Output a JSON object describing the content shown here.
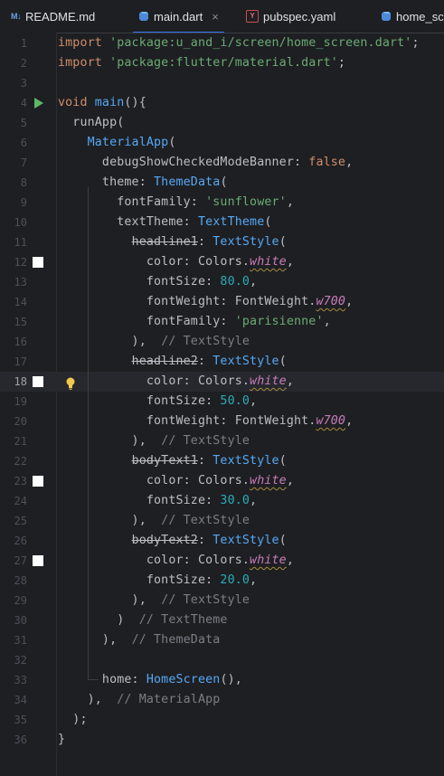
{
  "tabs": [
    {
      "label": "README.md",
      "icon": "markdown-icon",
      "active": false
    },
    {
      "label": "main.dart",
      "icon": "dart-icon",
      "active": true
    },
    {
      "label": "pubspec.yaml",
      "icon": "yaml-icon",
      "active": false
    },
    {
      "label": "home_sc",
      "icon": "dart-icon",
      "active": false
    }
  ],
  "tab_close_glyph": "×",
  "icon_texts": {
    "markdown": "M↓",
    "yaml": "Y"
  },
  "current_line": 18,
  "colors": {
    "keyword": "#cf8e6d",
    "string": "#6aab73",
    "function": "#56a8f5",
    "number": "#2aacb8",
    "comment": "#7a7e85",
    "field": "#c77dbb",
    "default": "#bcbec4",
    "accent": "#3574f0"
  },
  "gutter_markers": {
    "run_line": 4,
    "square_lines": [
      12,
      18,
      23,
      27
    ],
    "bulb_line": 18
  },
  "code_lines": [
    [
      [
        "kw",
        "import "
      ],
      [
        "str",
        "'package:u_and_i/screen/home_screen.dart'"
      ],
      [
        "",
        "; "
      ]
    ],
    [
      [
        "kw",
        "import "
      ],
      [
        "str",
        "'package:flutter/material.dart'"
      ],
      [
        "",
        ";"
      ]
    ],
    [],
    [
      [
        "kw",
        "void "
      ],
      [
        "fn",
        "main"
      ],
      [
        "",
        "(){"
      ]
    ],
    [
      [
        "",
        "  runApp("
      ]
    ],
    [
      [
        "",
        "    "
      ],
      [
        "cls",
        "MaterialApp"
      ],
      [
        "",
        "("
      ]
    ],
    [
      [
        "",
        "      debugShowCheckedModeBanner: "
      ],
      [
        "kw",
        "false"
      ],
      [
        "",
        ","
      ]
    ],
    [
      [
        "",
        "      theme: "
      ],
      [
        "cls",
        "ThemeData"
      ],
      [
        "",
        "("
      ]
    ],
    [
      [
        "",
        "        fontFamily: "
      ],
      [
        "str",
        "'sunflower'"
      ],
      [
        "",
        ","
      ]
    ],
    [
      [
        "",
        "        textTheme: "
      ],
      [
        "cls",
        "TextTheme"
      ],
      [
        "",
        "("
      ]
    ],
    [
      [
        "",
        "          "
      ],
      [
        "strike",
        "headline1"
      ],
      [
        "",
        ": "
      ],
      [
        "cls",
        "TextStyle"
      ],
      [
        "",
        "("
      ]
    ],
    [
      [
        "",
        "            color: Colors."
      ],
      [
        "field",
        "white"
      ],
      [
        "",
        ","
      ]
    ],
    [
      [
        "",
        "            fontSize: "
      ],
      [
        "num",
        "80.0"
      ],
      [
        "",
        ","
      ]
    ],
    [
      [
        "",
        "            fontWeight: FontWeight."
      ],
      [
        "field",
        "w700"
      ],
      [
        "",
        ","
      ]
    ],
    [
      [
        "",
        "            fontFamily: "
      ],
      [
        "str",
        "'parisienne'"
      ],
      [
        "",
        ","
      ]
    ],
    [
      [
        "",
        "          ),  "
      ],
      [
        "cmt",
        "// TextStyle"
      ]
    ],
    [
      [
        "",
        "          "
      ],
      [
        "strike",
        "headline2"
      ],
      [
        "",
        ": "
      ],
      [
        "cls",
        "TextStyle"
      ],
      [
        "",
        "("
      ]
    ],
    [
      [
        "",
        "            color: Colors."
      ],
      [
        "field",
        "white"
      ],
      [
        "",
        ","
      ]
    ],
    [
      [
        "",
        "            fontSize: "
      ],
      [
        "num",
        "50.0"
      ],
      [
        "",
        ","
      ]
    ],
    [
      [
        "",
        "            fontWeight: FontWeight."
      ],
      [
        "field",
        "w700"
      ],
      [
        "",
        ","
      ]
    ],
    [
      [
        "",
        "          ),  "
      ],
      [
        "cmt",
        "// TextStyle"
      ]
    ],
    [
      [
        "",
        "          "
      ],
      [
        "strike",
        "bodyText1"
      ],
      [
        "",
        ": "
      ],
      [
        "cls",
        "TextStyle"
      ],
      [
        "",
        "("
      ]
    ],
    [
      [
        "",
        "            color: Colors."
      ],
      [
        "field",
        "white"
      ],
      [
        "",
        ","
      ]
    ],
    [
      [
        "",
        "            fontSize: "
      ],
      [
        "num",
        "30.0"
      ],
      [
        "",
        ","
      ]
    ],
    [
      [
        "",
        "          ),  "
      ],
      [
        "cmt",
        "// TextStyle"
      ]
    ],
    [
      [
        "",
        "          "
      ],
      [
        "strike",
        "bodyText2"
      ],
      [
        "",
        ": "
      ],
      [
        "cls",
        "TextStyle"
      ],
      [
        "",
        "("
      ]
    ],
    [
      [
        "",
        "            color: Colors."
      ],
      [
        "field",
        "white"
      ],
      [
        "",
        ","
      ]
    ],
    [
      [
        "",
        "            fontSize: "
      ],
      [
        "num",
        "20.0"
      ],
      [
        "",
        ","
      ]
    ],
    [
      [
        "",
        "          ),  "
      ],
      [
        "cmt",
        "// TextStyle"
      ]
    ],
    [
      [
        "",
        "        )  "
      ],
      [
        "cmt",
        "// TextTheme"
      ]
    ],
    [
      [
        "",
        "      ),  "
      ],
      [
        "cmt",
        "// ThemeData"
      ]
    ],
    [],
    [
      [
        "",
        "      home: "
      ],
      [
        "cls",
        "HomeScreen"
      ],
      [
        "",
        "(),"
      ]
    ],
    [
      [
        "",
        "    ),  "
      ],
      [
        "cmt",
        "// MaterialApp"
      ]
    ],
    [
      [
        "",
        "  );"
      ]
    ],
    [
      [
        "",
        "}"
      ]
    ]
  ]
}
